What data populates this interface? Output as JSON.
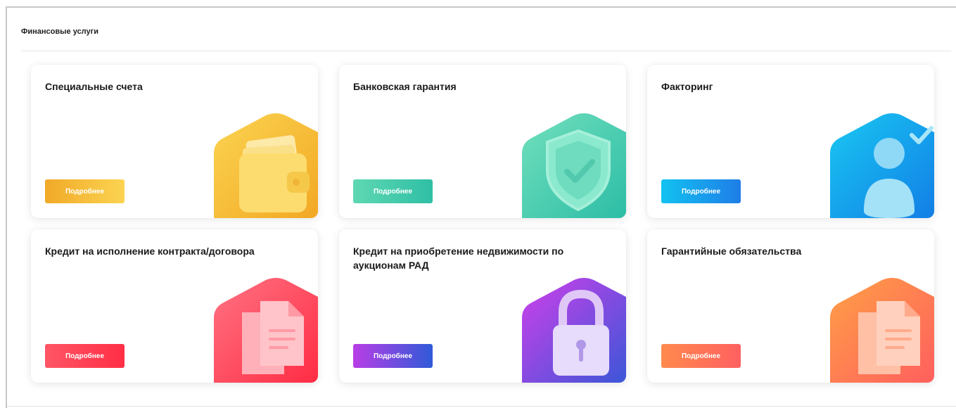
{
  "section": {
    "title": "Финансовые услуги"
  },
  "cards": [
    {
      "title": "Специальные счета",
      "button": "Подробнее",
      "icon": "wallet-icon",
      "colors": [
        "#f5b931",
        "#fbd451"
      ]
    },
    {
      "title": "Банковская гарантия",
      "button": "Подробнее",
      "icon": "shield-check-icon",
      "colors": [
        "#5fd8b2",
        "#36c2a6"
      ]
    },
    {
      "title": "Факторинг",
      "button": "Подробнее",
      "icon": "user-check-icon",
      "colors": [
        "#12c2f0",
        "#1078e8"
      ]
    },
    {
      "title": "Кредит на исполнение контракта/договора",
      "button": "Подробнее",
      "icon": "documents-icon",
      "colors": [
        "#ff6b7a",
        "#ff2f45"
      ]
    },
    {
      "title": "Кредит на приобретение недвижимости по аукционам РАД",
      "button": "Подробнее",
      "icon": "padlock-icon",
      "colors": [
        "#c53ee8",
        "#3d52d6"
      ]
    },
    {
      "title": "Гарантийные обязательства",
      "button": "Подробнее",
      "icon": "documents-icon",
      "colors": [
        "#ff9a4a",
        "#ff6a5c"
      ]
    }
  ]
}
